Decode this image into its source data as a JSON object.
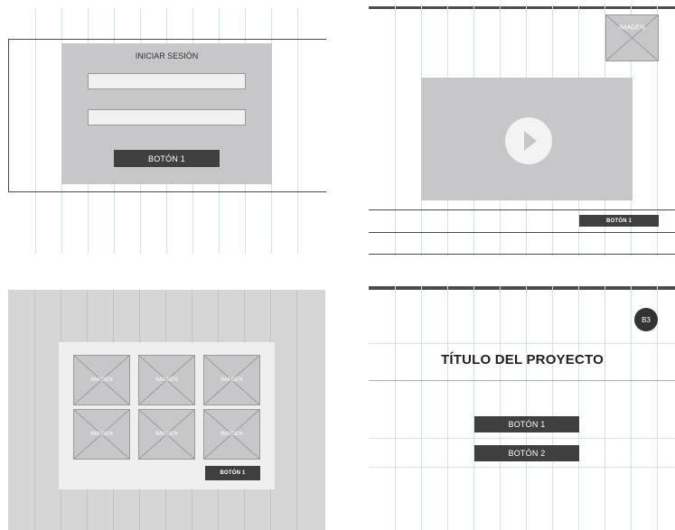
{
  "login_panel": {
    "title": "INICIAR SESIÓN",
    "button_label": "BOTÓN 1"
  },
  "video_panel": {
    "image_label": "IMAGEN",
    "button_label": "BOTÓN 1"
  },
  "gallery_panel": {
    "image_labels": [
      "IMAGEN",
      "IMAGEN",
      "IMAGEN",
      "IMAGEN",
      "IMAGEN",
      "IMAGEN"
    ],
    "button_label": "BOTÓN 1"
  },
  "project_panel": {
    "badge": "B3",
    "title": "TÍTULO DEL PROYECTO",
    "button1_label": "BOTÓN 1",
    "button2_label": "BOTÓN 2"
  }
}
